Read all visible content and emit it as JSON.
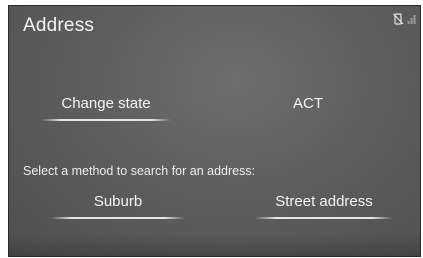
{
  "header": {
    "title": "Address"
  },
  "status": {
    "icons": [
      "phone-off-icon",
      "signal-icon"
    ]
  },
  "state_row": {
    "change_state_label": "Change state",
    "state_value": "ACT"
  },
  "search": {
    "prompt": "Select a method to search for an address:",
    "suburb_label": "Suburb",
    "street_address_label": "Street address"
  },
  "colors": {
    "background": "#5e5e5e",
    "text": "#f2f2f2"
  }
}
